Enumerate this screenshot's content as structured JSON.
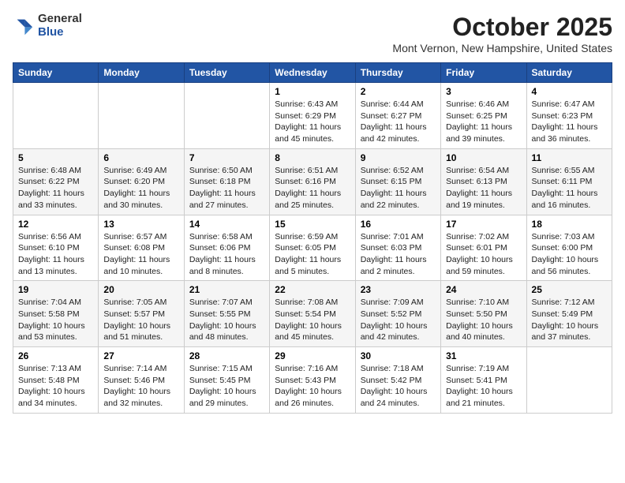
{
  "header": {
    "logo_general": "General",
    "logo_blue": "Blue",
    "month_title": "October 2025",
    "location": "Mont Vernon, New Hampshire, United States"
  },
  "weekdays": [
    "Sunday",
    "Monday",
    "Tuesday",
    "Wednesday",
    "Thursday",
    "Friday",
    "Saturday"
  ],
  "weeks": [
    [
      {
        "day": "",
        "detail": ""
      },
      {
        "day": "",
        "detail": ""
      },
      {
        "day": "",
        "detail": ""
      },
      {
        "day": "1",
        "detail": "Sunrise: 6:43 AM\nSunset: 6:29 PM\nDaylight: 11 hours\nand 45 minutes."
      },
      {
        "day": "2",
        "detail": "Sunrise: 6:44 AM\nSunset: 6:27 PM\nDaylight: 11 hours\nand 42 minutes."
      },
      {
        "day": "3",
        "detail": "Sunrise: 6:46 AM\nSunset: 6:25 PM\nDaylight: 11 hours\nand 39 minutes."
      },
      {
        "day": "4",
        "detail": "Sunrise: 6:47 AM\nSunset: 6:23 PM\nDaylight: 11 hours\nand 36 minutes."
      }
    ],
    [
      {
        "day": "5",
        "detail": "Sunrise: 6:48 AM\nSunset: 6:22 PM\nDaylight: 11 hours\nand 33 minutes."
      },
      {
        "day": "6",
        "detail": "Sunrise: 6:49 AM\nSunset: 6:20 PM\nDaylight: 11 hours\nand 30 minutes."
      },
      {
        "day": "7",
        "detail": "Sunrise: 6:50 AM\nSunset: 6:18 PM\nDaylight: 11 hours\nand 27 minutes."
      },
      {
        "day": "8",
        "detail": "Sunrise: 6:51 AM\nSunset: 6:16 PM\nDaylight: 11 hours\nand 25 minutes."
      },
      {
        "day": "9",
        "detail": "Sunrise: 6:52 AM\nSunset: 6:15 PM\nDaylight: 11 hours\nand 22 minutes."
      },
      {
        "day": "10",
        "detail": "Sunrise: 6:54 AM\nSunset: 6:13 PM\nDaylight: 11 hours\nand 19 minutes."
      },
      {
        "day": "11",
        "detail": "Sunrise: 6:55 AM\nSunset: 6:11 PM\nDaylight: 11 hours\nand 16 minutes."
      }
    ],
    [
      {
        "day": "12",
        "detail": "Sunrise: 6:56 AM\nSunset: 6:10 PM\nDaylight: 11 hours\nand 13 minutes."
      },
      {
        "day": "13",
        "detail": "Sunrise: 6:57 AM\nSunset: 6:08 PM\nDaylight: 11 hours\nand 10 minutes."
      },
      {
        "day": "14",
        "detail": "Sunrise: 6:58 AM\nSunset: 6:06 PM\nDaylight: 11 hours\nand 8 minutes."
      },
      {
        "day": "15",
        "detail": "Sunrise: 6:59 AM\nSunset: 6:05 PM\nDaylight: 11 hours\nand 5 minutes."
      },
      {
        "day": "16",
        "detail": "Sunrise: 7:01 AM\nSunset: 6:03 PM\nDaylight: 11 hours\nand 2 minutes."
      },
      {
        "day": "17",
        "detail": "Sunrise: 7:02 AM\nSunset: 6:01 PM\nDaylight: 10 hours\nand 59 minutes."
      },
      {
        "day": "18",
        "detail": "Sunrise: 7:03 AM\nSunset: 6:00 PM\nDaylight: 10 hours\nand 56 minutes."
      }
    ],
    [
      {
        "day": "19",
        "detail": "Sunrise: 7:04 AM\nSunset: 5:58 PM\nDaylight: 10 hours\nand 53 minutes."
      },
      {
        "day": "20",
        "detail": "Sunrise: 7:05 AM\nSunset: 5:57 PM\nDaylight: 10 hours\nand 51 minutes."
      },
      {
        "day": "21",
        "detail": "Sunrise: 7:07 AM\nSunset: 5:55 PM\nDaylight: 10 hours\nand 48 minutes."
      },
      {
        "day": "22",
        "detail": "Sunrise: 7:08 AM\nSunset: 5:54 PM\nDaylight: 10 hours\nand 45 minutes."
      },
      {
        "day": "23",
        "detail": "Sunrise: 7:09 AM\nSunset: 5:52 PM\nDaylight: 10 hours\nand 42 minutes."
      },
      {
        "day": "24",
        "detail": "Sunrise: 7:10 AM\nSunset: 5:50 PM\nDaylight: 10 hours\nand 40 minutes."
      },
      {
        "day": "25",
        "detail": "Sunrise: 7:12 AM\nSunset: 5:49 PM\nDaylight: 10 hours\nand 37 minutes."
      }
    ],
    [
      {
        "day": "26",
        "detail": "Sunrise: 7:13 AM\nSunset: 5:48 PM\nDaylight: 10 hours\nand 34 minutes."
      },
      {
        "day": "27",
        "detail": "Sunrise: 7:14 AM\nSunset: 5:46 PM\nDaylight: 10 hours\nand 32 minutes."
      },
      {
        "day": "28",
        "detail": "Sunrise: 7:15 AM\nSunset: 5:45 PM\nDaylight: 10 hours\nand 29 minutes."
      },
      {
        "day": "29",
        "detail": "Sunrise: 7:16 AM\nSunset: 5:43 PM\nDaylight: 10 hours\nand 26 minutes."
      },
      {
        "day": "30",
        "detail": "Sunrise: 7:18 AM\nSunset: 5:42 PM\nDaylight: 10 hours\nand 24 minutes."
      },
      {
        "day": "31",
        "detail": "Sunrise: 7:19 AM\nSunset: 5:41 PM\nDaylight: 10 hours\nand 21 minutes."
      },
      {
        "day": "",
        "detail": ""
      }
    ]
  ]
}
